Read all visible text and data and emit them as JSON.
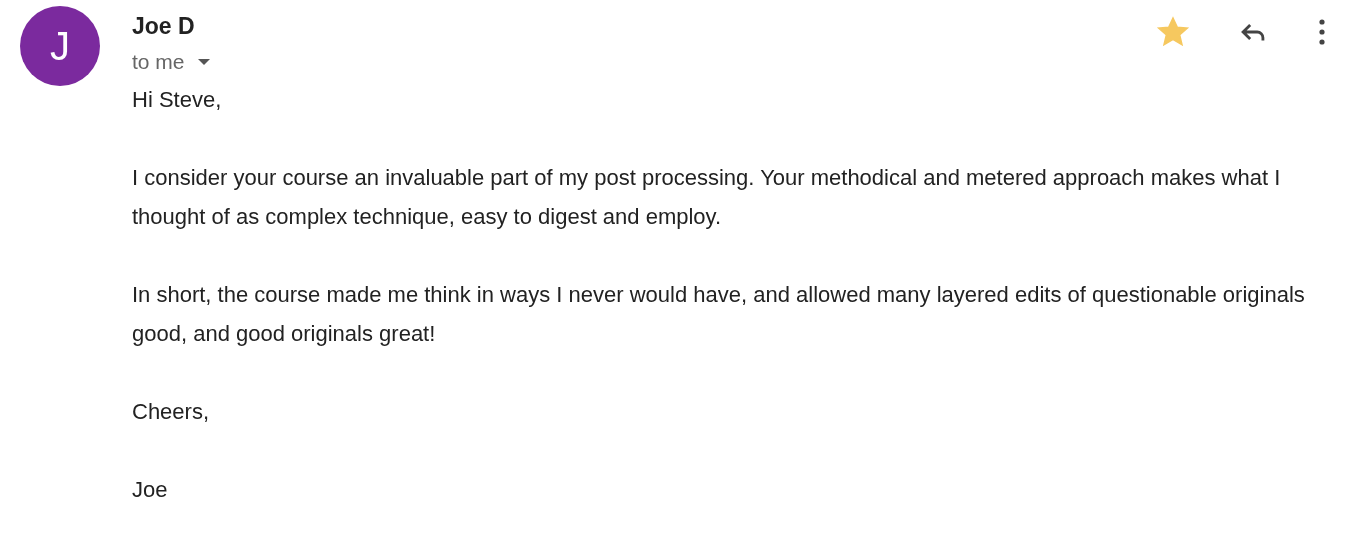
{
  "sender": {
    "avatar_letter": "J",
    "name": "Joe D",
    "recipient": "to me"
  },
  "starred": true,
  "body": [
    "Hi Steve,",
    "I consider your course an invaluable part of my post processing. Your methodical and metered approach makes what I thought of as complex technique, easy to digest and employ.",
    "In short, the course made me think in ways I never would have, and allowed many layered edits of questionable originals good, and good originals great!",
    "Cheers,",
    "Joe"
  ]
}
